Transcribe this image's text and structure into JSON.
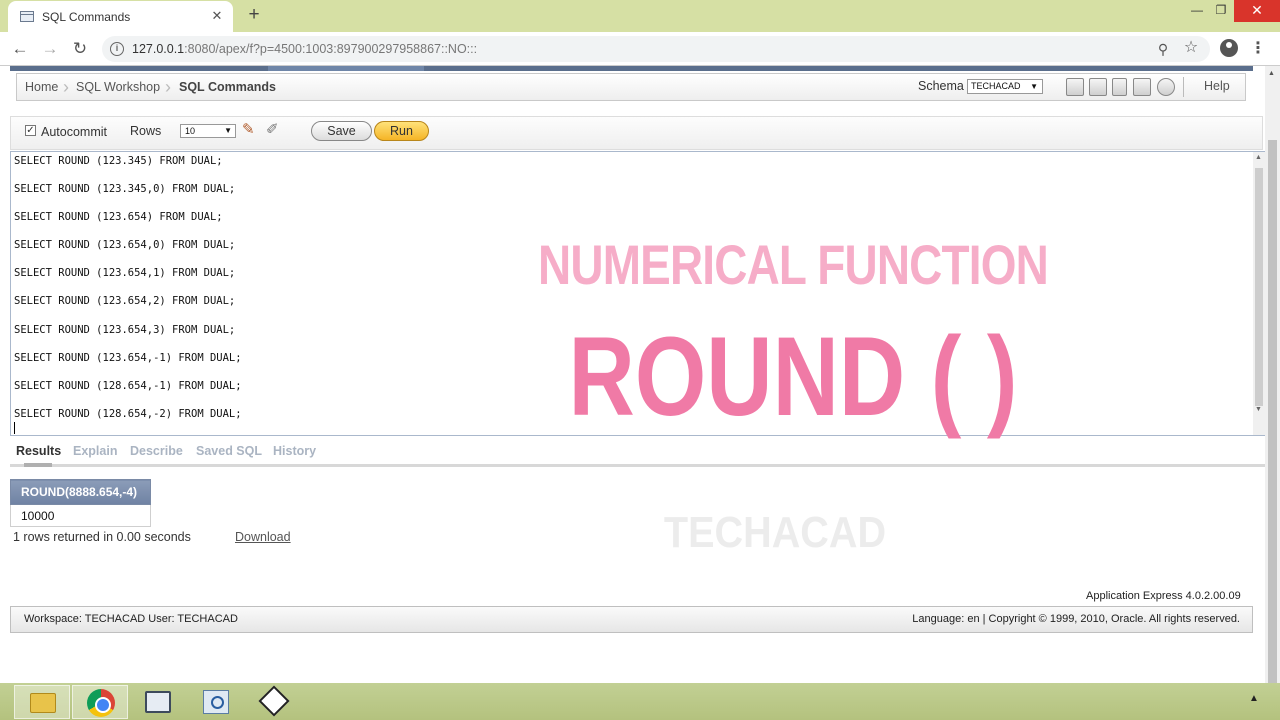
{
  "browser": {
    "tab_title": "SQL Commands",
    "tab_close": "✕",
    "new_tab": "+",
    "url_host": "127.0.0.1",
    "url_rest": ":8080/apex/f?p=4500:1003:897900297958867::NO:::",
    "window_controls": {
      "minimize": "—",
      "maximize": "❐",
      "close": "✕"
    }
  },
  "breadcrumb": [
    "Home",
    "SQL Workshop",
    "SQL Commands"
  ],
  "schema": {
    "label": "Schema",
    "value": "TECHACAD"
  },
  "help_label": "Help",
  "toolbar": {
    "autocommit_label": "Autocommit",
    "autocommit_checked": true,
    "rows_label": "Rows",
    "rows_value": "10",
    "save_label": "Save",
    "run_label": "Run"
  },
  "sql_lines": [
    "SELECT ROUND (123.345) FROM DUAL;",
    "SELECT ROUND (123.345,0) FROM DUAL;",
    "SELECT ROUND (123.654) FROM DUAL;",
    "SELECT ROUND (123.654,0) FROM DUAL;",
    "SELECT ROUND (123.654,1) FROM DUAL;",
    "SELECT ROUND (123.654,2) FROM DUAL;",
    "SELECT ROUND (123.654,3) FROM DUAL;",
    "SELECT ROUND (123.654,-1) FROM DUAL;",
    "SELECT ROUND (128.654,-1) FROM DUAL;",
    "SELECT ROUND (128.654,-2) FROM DUAL;"
  ],
  "overlay": {
    "title": "NUMERICAL FUNCTION",
    "function": "ROUND ( )",
    "brand": "TECHACAD"
  },
  "result_tabs": [
    "Results",
    "Explain",
    "Describe",
    "Saved SQL",
    "History"
  ],
  "results": {
    "column_header": "ROUND(8888.654,-4)",
    "value": "10000",
    "summary": "1 rows returned in 0.00 seconds",
    "download_label": "Download"
  },
  "footer": {
    "version": "Application Express 4.0.2.00.09",
    "workspace": "Workspace: TECHACAD User: TECHACAD",
    "copyright": "Language: en | Copyright © 1999, 2010, Oracle. All rights reserved."
  },
  "colors": {
    "run_button": "#f5b426",
    "overlay_title": "#f6adc8",
    "overlay_function": "#f07aa6",
    "results_header": "#7a8aa6",
    "tabstrip": "#d6e0a4"
  }
}
